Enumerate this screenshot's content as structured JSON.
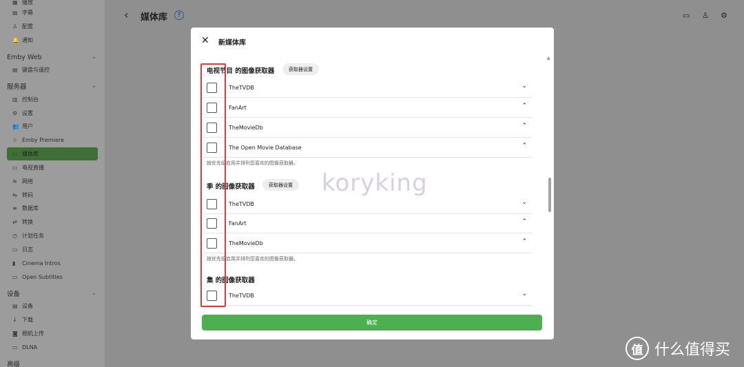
{
  "sidebar": {
    "top_items": [
      {
        "icon": "▦",
        "label": "播放"
      },
      {
        "icon": "▤",
        "label": "字幕"
      },
      {
        "icon": "♙",
        "label": "配置"
      },
      {
        "icon": "🔔",
        "label": "通知"
      }
    ],
    "emby_web": {
      "title": "Emby Web",
      "items": [
        {
          "icon": "▤",
          "label": "键盘与遥控"
        }
      ]
    },
    "server": {
      "title": "服务器",
      "items": [
        {
          "icon": "▥",
          "label": "控制台"
        },
        {
          "icon": "⚙",
          "label": "设置"
        },
        {
          "icon": "👥",
          "label": "用户"
        },
        {
          "icon": "☆",
          "label": "Emby Premiere"
        },
        {
          "icon": "▭",
          "label": "媒体库"
        },
        {
          "icon": "▭",
          "label": "电视直播"
        },
        {
          "icon": "≋",
          "label": "网络"
        },
        {
          "icon": "⇆",
          "label": "转码"
        },
        {
          "icon": "≡",
          "label": "数据库"
        },
        {
          "icon": "⇄",
          "label": "转换"
        },
        {
          "icon": "◷",
          "label": "计划任务"
        },
        {
          "icon": "▭",
          "label": "日志"
        },
        {
          "icon": "▮",
          "label": "Cinema Intros"
        },
        {
          "icon": "▭",
          "label": "Open Subtitles"
        }
      ],
      "active_index": 4
    },
    "devices": {
      "title": "设备",
      "items": [
        {
          "icon": "▤",
          "label": "设备"
        },
        {
          "icon": "↓",
          "label": "下载"
        },
        {
          "icon": "◙",
          "label": "相机上传"
        },
        {
          "icon": "▭",
          "label": "DLNA"
        }
      ]
    },
    "advanced": {
      "title": "高级"
    }
  },
  "header": {
    "back_icon": "chevron-left-icon",
    "title": "媒体库",
    "help_glyph": "?",
    "cast_icon": "cast-icon",
    "user_icon": "user-icon",
    "settings_icon": "gear-icon"
  },
  "dialog": {
    "title": "新媒体库",
    "sections": [
      {
        "title": "电视节目 的图像获取器",
        "button": "获取器设置",
        "rows": [
          {
            "label": "TheTVDB",
            "chevron": "⌄"
          },
          {
            "label": "FanArt",
            "chevron": "⌃"
          },
          {
            "label": "TheMovieDb",
            "chevron": "⌃"
          },
          {
            "label": "The Open Movie Database",
            "chevron": "⌃"
          }
        ],
        "hint": "按优先级启用并排列您喜欢的图像获取器。"
      },
      {
        "title": "季 的图像获取器",
        "button": "获取器设置",
        "rows": [
          {
            "label": "TheTVDB",
            "chevron": "⌄"
          },
          {
            "label": "FanArt",
            "chevron": "⌃"
          },
          {
            "label": "TheMovieDb",
            "chevron": "⌃"
          }
        ],
        "hint": "按优先级启用并排列您喜欢的图像获取器。"
      },
      {
        "title": "集 的图像获取器",
        "rows": [
          {
            "label": "TheTVDB",
            "chevron": "⌄"
          }
        ]
      }
    ],
    "confirm_label": "确定",
    "watermark": "koryking"
  },
  "site_watermark": {
    "logo": "值",
    "text": "什么值得买"
  },
  "colors": {
    "accent": "#4caf50",
    "highlight": "#e53935",
    "sidebar_active": "#3e6f35"
  }
}
